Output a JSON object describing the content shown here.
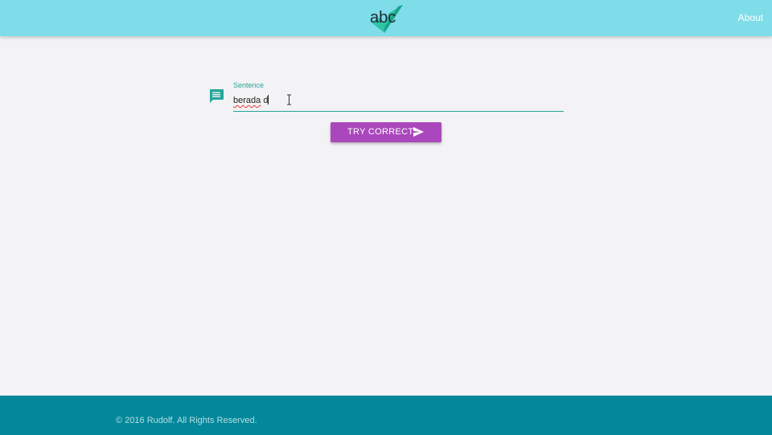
{
  "header": {
    "logo_text": "abc",
    "about_label": "About"
  },
  "form": {
    "field_label": "Sentence",
    "input_value": "berada d",
    "misspelled_word": "berada",
    "after_word": " d",
    "icon": "comment-icon"
  },
  "actions": {
    "try_label": "TRY CORRECT",
    "send_icon": "send-icon"
  },
  "footer": {
    "copyright": "© 2016 Rudolf. All Rights Reserved."
  },
  "colors": {
    "header_bg": "#7fdde9",
    "accent_teal": "#26a69a",
    "button_purple": "#ab47bc",
    "footer_bg": "#02889a",
    "page_bg": "#f3f2f4"
  }
}
